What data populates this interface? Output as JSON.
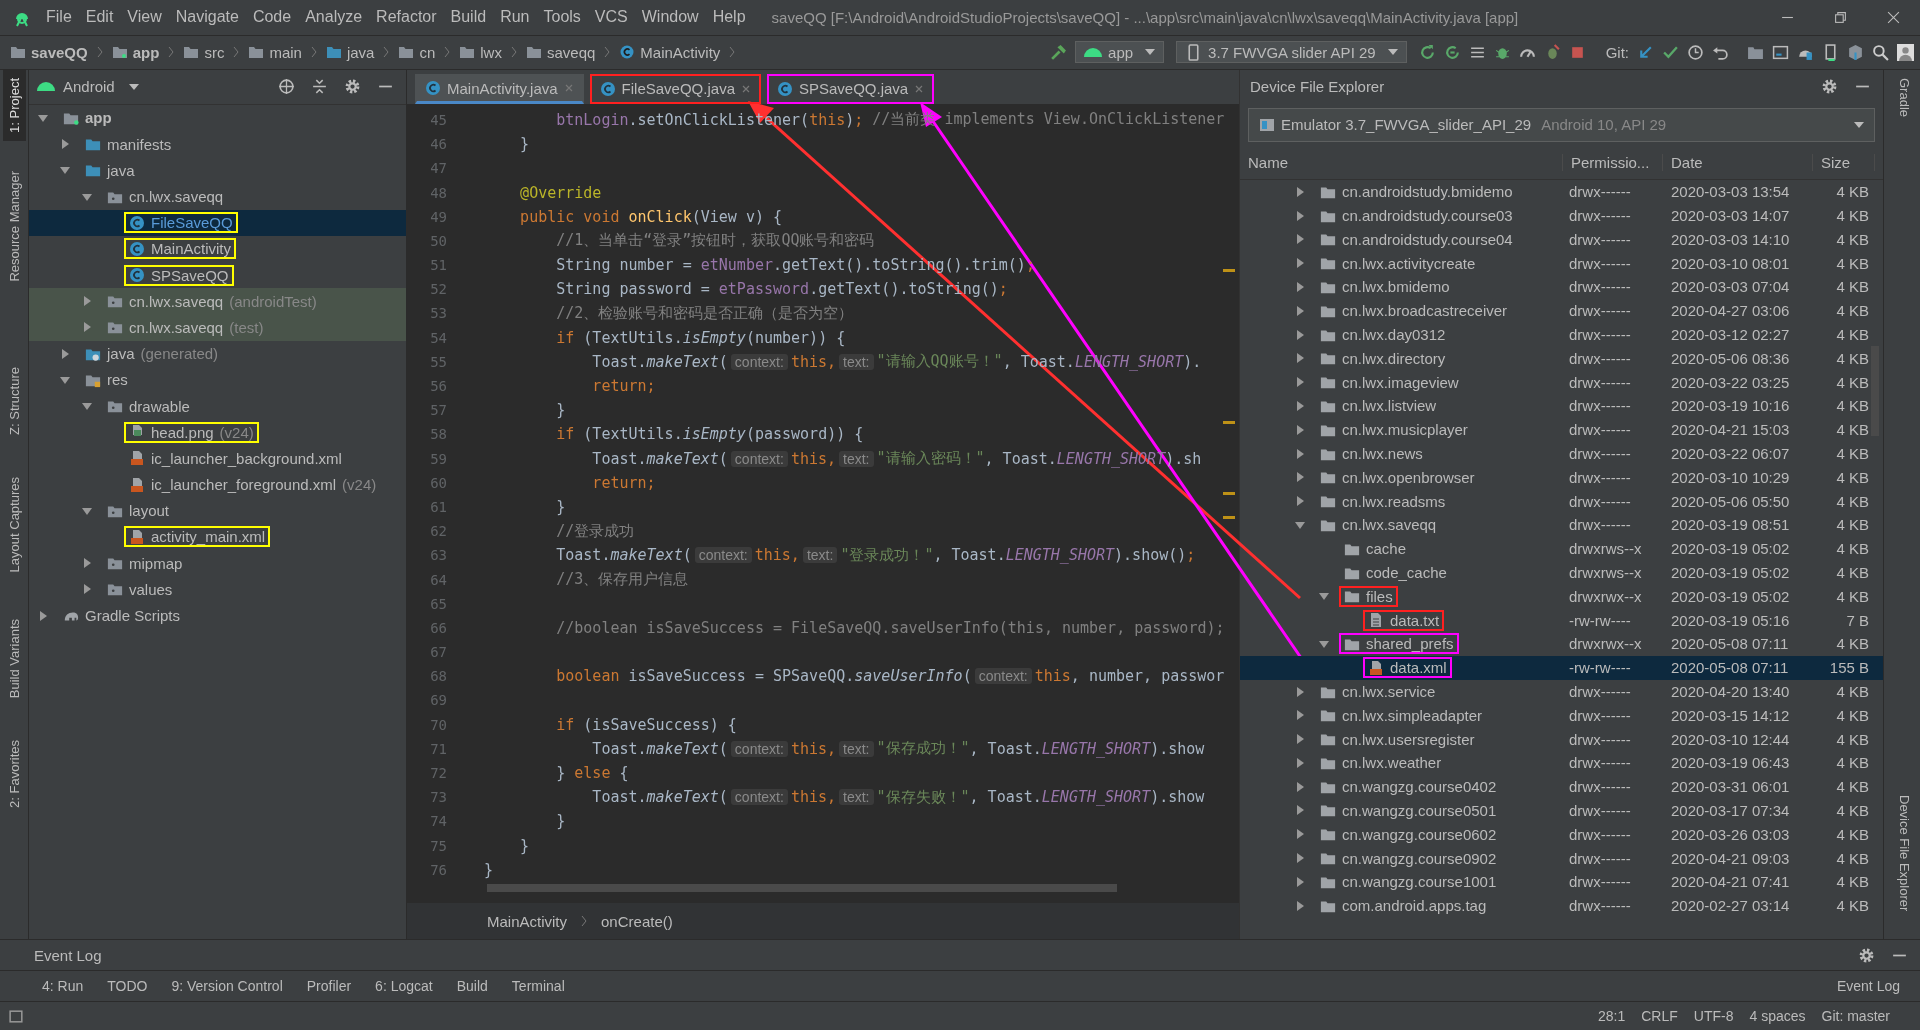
{
  "menu_bar": {
    "items": [
      "File",
      "Edit",
      "View",
      "Navigate",
      "Code",
      "Analyze",
      "Refactor",
      "Build",
      "Run",
      "Tools",
      "VCS",
      "Window",
      "Help"
    ],
    "title": "saveQQ [F:\\Android\\AndroidStudioProjects\\saveQQ] - ...\\app\\src\\main\\java\\cn\\lwx\\saveqq\\MainActivity.java [app]"
  },
  "nav_bar": {
    "breadcrumbs": [
      {
        "label": "saveQQ",
        "kind": "project"
      },
      {
        "label": "app",
        "kind": "module"
      },
      {
        "label": "src",
        "kind": "folder"
      },
      {
        "label": "main",
        "kind": "folder"
      },
      {
        "label": "java",
        "kind": "source"
      },
      {
        "label": "cn",
        "kind": "folder"
      },
      {
        "label": "lwx",
        "kind": "folder"
      },
      {
        "label": "saveqq",
        "kind": "folder"
      },
      {
        "label": "MainActivity",
        "kind": "class"
      }
    ],
    "run_config": "app",
    "device": "3.7  FWVGA slider API 29",
    "git_label": "Git:"
  },
  "left_tool_windows": [
    {
      "label": "1: Project",
      "selected": true
    },
    {
      "label": "Resource Manager",
      "selected": false
    },
    {
      "label": "Z: Structure",
      "selected": false
    },
    {
      "label": "Layout Captures",
      "selected": false
    },
    {
      "label": "Build Variants",
      "selected": false
    },
    {
      "label": "2: Favorites",
      "selected": false
    }
  ],
  "project_panel": {
    "view": "Android",
    "tree": [
      {
        "label": "app",
        "kind": "module",
        "expanded": true,
        "selected": false,
        "children": [
          {
            "label": "manifests",
            "kind": "folder",
            "expanded": false,
            "selected": false
          },
          {
            "label": "java",
            "kind": "folder",
            "expanded": true,
            "selected": false,
            "children": [
              {
                "label": "cn.lwx.saveqq",
                "kind": "package",
                "expanded": true,
                "selected": false,
                "tinted": false,
                "children": [
                  {
                    "label": "FileSaveQQ",
                    "kind": "class",
                    "selected": true,
                    "color": "#ffff00"
                  },
                  {
                    "label": "MainActivity",
                    "kind": "class",
                    "selected": false,
                    "color": "#ffff00"
                  },
                  {
                    "label": "SPSaveQQ",
                    "kind": "class",
                    "selected": false,
                    "color": "#ffff00"
                  }
                ]
              },
              {
                "label": "cn.lwx.saveqq",
                "suffix": "(androidTest)",
                "kind": "package",
                "expanded": false,
                "selected": false,
                "tinted": true
              },
              {
                "label": "cn.lwx.saveqq",
                "suffix": "(test)",
                "kind": "package",
                "expanded": false,
                "selected": false,
                "tinted": true
              }
            ]
          },
          {
            "label": "java",
            "suffix": "(generated)",
            "kind": "generated",
            "expanded": false,
            "selected": false
          },
          {
            "label": "res",
            "kind": "res",
            "expanded": true,
            "selected": false,
            "children": [
              {
                "label": "drawable",
                "kind": "package",
                "expanded": true,
                "selected": false,
                "children": [
                  {
                    "label": "head.png",
                    "suffix": "(v24)",
                    "kind": "image",
                    "selected": false,
                    "color": "#ffff00"
                  },
                  {
                    "label": "ic_launcher_background.xml",
                    "kind": "xml",
                    "selected": false
                  },
                  {
                    "label": "ic_launcher_foreground.xml",
                    "suffix": "(v24)",
                    "kind": "xml",
                    "selected": false
                  }
                ]
              },
              {
                "label": "layout",
                "kind": "package",
                "expanded": true,
                "selected": false,
                "children": [
                  {
                    "label": "activity_main.xml",
                    "kind": "xml",
                    "selected": false,
                    "color": "#ffff00"
                  }
                ]
              },
              {
                "label": "mipmap",
                "kind": "package",
                "expanded": false,
                "selected": false
              },
              {
                "label": "values",
                "kind": "package",
                "expanded": false,
                "selected": false
              }
            ]
          }
        ]
      },
      {
        "label": "Gradle Scripts",
        "kind": "gradle",
        "expanded": false,
        "selected": false
      }
    ]
  },
  "editor": {
    "tabs": [
      {
        "label": "MainActivity.java",
        "selected": true
      },
      {
        "label": "FileSaveQQ.java",
        "selected": false,
        "color": "#ff2020"
      },
      {
        "label": "SPSaveQQ.java",
        "selected": false,
        "color": "#ff00ff"
      }
    ],
    "lines": [
      {
        "number": "45",
        "tokens": [
          {
            "kind": "field",
            "text": "        btnLogin"
          },
          {
            "kind": "plain",
            "text": ".setOnClickListener("
          },
          {
            "kind": "keyword",
            "text": "this"
          },
          {
            "kind": "plain",
            "text": ")"
          },
          {
            "kind": "keyword",
            "text": ";"
          },
          {
            "kind": "comment",
            "text": " //当前类 implements View.OnClickListener"
          }
        ]
      },
      {
        "number": "46",
        "tokens": [
          {
            "kind": "plain",
            "text": "    }"
          }
        ]
      },
      {
        "number": "47"
      },
      {
        "number": "48",
        "tokens": [
          {
            "kind": "annotation",
            "text": "    @Override"
          }
        ]
      },
      {
        "number": "49",
        "tokens": [
          {
            "kind": "keyword",
            "text": "    public void "
          },
          {
            "kind": "method",
            "text": "onClick"
          },
          {
            "kind": "plain",
            "text": "(View v) {"
          }
        ]
      },
      {
        "number": "50",
        "tokens": [
          {
            "kind": "comment",
            "text": "        //1、当单击“登录”按钮时，获取QQ账号和密码"
          }
        ]
      },
      {
        "number": "51",
        "tokens": [
          {
            "kind": "plain",
            "text": "        String number = "
          },
          {
            "kind": "field",
            "text": "etNumber"
          },
          {
            "kind": "plain",
            "text": ".getText().toString().trim()"
          },
          {
            "kind": "keyword",
            "text": ";"
          }
        ]
      },
      {
        "number": "52",
        "tokens": [
          {
            "kind": "plain",
            "text": "        String password = "
          },
          {
            "kind": "field",
            "text": "etPassword"
          },
          {
            "kind": "plain",
            "text": ".getText().toString()"
          },
          {
            "kind": "keyword",
            "text": ";"
          }
        ]
      },
      {
        "number": "53",
        "tokens": [
          {
            "kind": "comment",
            "text": "        //2、检验账号和密码是否正确（是否为空）"
          }
        ]
      },
      {
        "number": "54",
        "tokens": [
          {
            "kind": "keyword",
            "text": "        if "
          },
          {
            "kind": "plain",
            "text": "(TextUtils."
          },
          {
            "kind": "italic",
            "text": "isEmpty"
          },
          {
            "kind": "plain",
            "text": "(number)) {"
          }
        ]
      },
      {
        "number": "55",
        "tokens": [
          {
            "kind": "plain",
            "text": "            Toast."
          },
          {
            "kind": "italic",
            "text": "makeText"
          },
          {
            "kind": "plain",
            "text": "("
          },
          {
            "kind": "hint",
            "text": "context:"
          },
          {
            "kind": "keyword",
            "text": "this,"
          },
          {
            "kind": "hint",
            "text": "text:"
          },
          {
            "kind": "string",
            "text": "\"请输入QQ账号！\""
          },
          {
            "kind": "plain",
            "text": ", Toast."
          },
          {
            "kind": "constant",
            "text": "LENGTH_SHORT"
          },
          {
            "kind": "plain",
            "text": ")."
          }
        ]
      },
      {
        "number": "56",
        "tokens": [
          {
            "kind": "keyword",
            "text": "            return;"
          }
        ]
      },
      {
        "number": "57",
        "tokens": [
          {
            "kind": "plain",
            "text": "        }"
          }
        ]
      },
      {
        "number": "58",
        "tokens": [
          {
            "kind": "keyword",
            "text": "        if "
          },
          {
            "kind": "plain",
            "text": "(TextUtils."
          },
          {
            "kind": "italic",
            "text": "isEmpty"
          },
          {
            "kind": "plain",
            "text": "(password)) {"
          }
        ]
      },
      {
        "number": "59",
        "tokens": [
          {
            "kind": "plain",
            "text": "            Toast."
          },
          {
            "kind": "italic",
            "text": "makeText"
          },
          {
            "kind": "plain",
            "text": "("
          },
          {
            "kind": "hint",
            "text": "context:"
          },
          {
            "kind": "keyword",
            "text": "this,"
          },
          {
            "kind": "hint",
            "text": "text:"
          },
          {
            "kind": "string",
            "text": "\"请输入密码！\""
          },
          {
            "kind": "plain",
            "text": ", Toast."
          },
          {
            "kind": "constant",
            "text": "LENGTH_SHORT"
          },
          {
            "kind": "plain",
            "text": ").sh"
          }
        ]
      },
      {
        "number": "60",
        "tokens": [
          {
            "kind": "keyword",
            "text": "            return;"
          }
        ]
      },
      {
        "number": "61",
        "tokens": [
          {
            "kind": "plain",
            "text": "        }"
          }
        ]
      },
      {
        "number": "62",
        "tokens": [
          {
            "kind": "comment",
            "text": "        //登录成功"
          }
        ]
      },
      {
        "number": "63",
        "tokens": [
          {
            "kind": "plain",
            "text": "        Toast."
          },
          {
            "kind": "italic",
            "text": "makeText"
          },
          {
            "kind": "plain",
            "text": "("
          },
          {
            "kind": "hint",
            "text": "context:"
          },
          {
            "kind": "keyword",
            "text": "this,"
          },
          {
            "kind": "hint",
            "text": "text:"
          },
          {
            "kind": "string",
            "text": "\"登录成功！\""
          },
          {
            "kind": "plain",
            "text": ", Toast."
          },
          {
            "kind": "constant",
            "text": "LENGTH_SHORT"
          },
          {
            "kind": "plain",
            "text": ").show()"
          },
          {
            "kind": "keyword",
            "text": ";"
          }
        ]
      },
      {
        "number": "64",
        "tokens": [
          {
            "kind": "comment",
            "text": "        //3、保存用户信息"
          }
        ]
      },
      {
        "number": "65"
      },
      {
        "number": "66",
        "tokens": [
          {
            "kind": "comment",
            "text": "        //boolean isSaveSuccess = FileSaveQQ.saveUserInfo(this, number, password);"
          }
        ]
      },
      {
        "number": "67"
      },
      {
        "number": "68",
        "tokens": [
          {
            "kind": "keyword",
            "text": "        boolean "
          },
          {
            "kind": "plain",
            "text": "isSaveSuccess = SPSaveQQ."
          },
          {
            "kind": "italic",
            "text": "saveUserInfo"
          },
          {
            "kind": "plain",
            "text": "("
          },
          {
            "kind": "hint",
            "text": "context:"
          },
          {
            "kind": "keyword",
            "text": "this"
          },
          {
            "kind": "plain",
            "text": ", number, passwor"
          }
        ]
      },
      {
        "number": "69"
      },
      {
        "number": "70",
        "tokens": [
          {
            "kind": "keyword",
            "text": "        if "
          },
          {
            "kind": "plain",
            "text": "(isSaveSuccess) {"
          }
        ]
      },
      {
        "number": "71",
        "tokens": [
          {
            "kind": "plain",
            "text": "            Toast."
          },
          {
            "kind": "italic",
            "text": "makeText"
          },
          {
            "kind": "plain",
            "text": "("
          },
          {
            "kind": "hint",
            "text": "context:"
          },
          {
            "kind": "keyword",
            "text": "this,"
          },
          {
            "kind": "hint",
            "text": "text:"
          },
          {
            "kind": "string",
            "text": "\"保存成功！\""
          },
          {
            "kind": "plain",
            "text": ", Toast."
          },
          {
            "kind": "constant",
            "text": "LENGTH_SHORT"
          },
          {
            "kind": "plain",
            "text": ").show"
          }
        ]
      },
      {
        "number": "72",
        "tokens": [
          {
            "kind": "plain",
            "text": "        } "
          },
          {
            "kind": "keyword",
            "text": "else "
          },
          {
            "kind": "plain",
            "text": "{"
          }
        ]
      },
      {
        "number": "73",
        "tokens": [
          {
            "kind": "plain",
            "text": "            Toast."
          },
          {
            "kind": "italic",
            "text": "makeText"
          },
          {
            "kind": "plain",
            "text": "("
          },
          {
            "kind": "hint",
            "text": "context:"
          },
          {
            "kind": "keyword",
            "text": "this,"
          },
          {
            "kind": "hint",
            "text": "text:"
          },
          {
            "kind": "string",
            "text": "\"保存失败！\""
          },
          {
            "kind": "plain",
            "text": ", Toast."
          },
          {
            "kind": "constant",
            "text": "LENGTH_SHORT"
          },
          {
            "kind": "plain",
            "text": ").show"
          }
        ]
      },
      {
        "number": "74",
        "tokens": [
          {
            "kind": "plain",
            "text": "        }"
          }
        ]
      },
      {
        "number": "75",
        "tokens": [
          {
            "kind": "plain",
            "text": "    }"
          }
        ]
      },
      {
        "number": "76",
        "tokens": [
          {
            "kind": "plain",
            "text": "}"
          }
        ]
      }
    ],
    "breadcrumbs": [
      "MainActivity",
      "onCreate()"
    ]
  },
  "device_file_explorer": {
    "title": "Device File Explorer",
    "device": "Emulator 3.7_FWVGA_slider_API_29",
    "device_info": "Android 10, API 29",
    "columns": [
      "Name",
      "Permissio...",
      "Date",
      "Size"
    ],
    "rows": [
      {
        "name": "cn.androidstudy.bmidemo",
        "kind": "folder",
        "expanded": false,
        "selected": false,
        "permissions": "drwx------",
        "date": "2020-03-03 13:54",
        "size": "4 KB"
      },
      {
        "name": "cn.androidstudy.course03",
        "kind": "folder",
        "expanded": false,
        "selected": false,
        "permissions": "drwx------",
        "date": "2020-03-03 14:07",
        "size": "4 KB"
      },
      {
        "name": "cn.androidstudy.course04",
        "kind": "folder",
        "expanded": false,
        "selected": false,
        "permissions": "drwx------",
        "date": "2020-03-03 14:10",
        "size": "4 KB"
      },
      {
        "name": "cn.lwx.activitycreate",
        "kind": "folder",
        "expanded": false,
        "selected": false,
        "permissions": "drwx------",
        "date": "2020-03-10 08:01",
        "size": "4 KB"
      },
      {
        "name": "cn.lwx.bmidemo",
        "kind": "folder",
        "expanded": false,
        "selected": false,
        "permissions": "drwx------",
        "date": "2020-03-03 07:04",
        "size": "4 KB"
      },
      {
        "name": "cn.lwx.broadcastreceiver",
        "kind": "folder",
        "expanded": false,
        "selected": false,
        "permissions": "drwx------",
        "date": "2020-04-27 03:06",
        "size": "4 KB"
      },
      {
        "name": "cn.lwx.day0312",
        "kind": "folder",
        "expanded": false,
        "selected": false,
        "permissions": "drwx------",
        "date": "2020-03-12 02:27",
        "size": "4 KB"
      },
      {
        "name": "cn.lwx.directory",
        "kind": "folder",
        "expanded": false,
        "selected": false,
        "permissions": "drwx------",
        "date": "2020-05-06 08:36",
        "size": "4 KB"
      },
      {
        "name": "cn.lwx.imageview",
        "kind": "folder",
        "expanded": false,
        "selected": false,
        "permissions": "drwx------",
        "date": "2020-03-22 03:25",
        "size": "4 KB"
      },
      {
        "name": "cn.lwx.listview",
        "kind": "folder",
        "expanded": false,
        "selected": false,
        "permissions": "drwx------",
        "date": "2020-03-19 10:16",
        "size": "4 KB"
      },
      {
        "name": "cn.lwx.musicplayer",
        "kind": "folder",
        "expanded": false,
        "selected": false,
        "permissions": "drwx------",
        "date": "2020-04-21 15:03",
        "size": "4 KB"
      },
      {
        "name": "cn.lwx.news",
        "kind": "folder",
        "expanded": false,
        "selected": false,
        "permissions": "drwx------",
        "date": "2020-03-22 06:07",
        "size": "4 KB"
      },
      {
        "name": "cn.lwx.openbrowser",
        "kind": "folder",
        "expanded": false,
        "selected": false,
        "permissions": "drwx------",
        "date": "2020-03-10 10:29",
        "size": "4 KB"
      },
      {
        "name": "cn.lwx.readsms",
        "kind": "folder",
        "expanded": false,
        "selected": false,
        "permissions": "drwx------",
        "date": "2020-05-06 05:50",
        "size": "4 KB"
      },
      {
        "name": "cn.lwx.saveqq",
        "kind": "folder",
        "expanded": true,
        "selected": false,
        "permissions": "drwx------",
        "date": "2020-03-19 08:51",
        "size": "4 KB",
        "children": [
          {
            "name": "cache",
            "kind": "folder",
            "selected": false,
            "permissions": "drwxrws--x",
            "date": "2020-03-19 05:02",
            "size": "4 KB"
          },
          {
            "name": "code_cache",
            "kind": "folder",
            "selected": false,
            "permissions": "drwxrws--x",
            "date": "2020-03-19 05:02",
            "size": "4 KB"
          },
          {
            "name": "files",
            "kind": "folder",
            "expanded": true,
            "selected": false,
            "color": "#ff2020",
            "permissions": "drwxrwx--x",
            "date": "2020-03-19 05:02",
            "size": "4 KB",
            "children": [
              {
                "name": "data.txt",
                "kind": "file",
                "selected": false,
                "color": "#ff2020",
                "permissions": "-rw-rw----",
                "date": "2020-03-19 05:16",
                "size": "7 B"
              }
            ]
          },
          {
            "name": "shared_prefs",
            "kind": "folder",
            "expanded": true,
            "selected": false,
            "color": "#ff00ff",
            "permissions": "drwxrwx--x",
            "date": "2020-05-08 07:11",
            "size": "4 KB",
            "children": [
              {
                "name": "data.xml",
                "kind": "xml",
                "selected": true,
                "color": "#ff00ff",
                "permissions": "-rw-rw----",
                "date": "2020-05-08 07:11",
                "size": "155 B"
              }
            ]
          }
        ]
      },
      {
        "name": "cn.lwx.service",
        "kind": "folder",
        "expanded": false,
        "selected": false,
        "permissions": "drwx------",
        "date": "2020-04-20 13:40",
        "size": "4 KB"
      },
      {
        "name": "cn.lwx.simpleadapter",
        "kind": "folder",
        "expanded": false,
        "selected": false,
        "permissions": "drwx------",
        "date": "2020-03-15 14:12",
        "size": "4 KB"
      },
      {
        "name": "cn.lwx.usersregister",
        "kind": "folder",
        "expanded": false,
        "selected": false,
        "permissions": "drwx------",
        "date": "2020-03-10 12:44",
        "size": "4 KB"
      },
      {
        "name": "cn.lwx.weather",
        "kind": "folder",
        "expanded": false,
        "selected": false,
        "permissions": "drwx------",
        "date": "2020-03-19 06:43",
        "size": "4 KB"
      },
      {
        "name": "cn.wangzg.course0402",
        "kind": "folder",
        "expanded": false,
        "selected": false,
        "permissions": "drwx------",
        "date": "2020-03-31 06:01",
        "size": "4 KB"
      },
      {
        "name": "cn.wangzg.course0501",
        "kind": "folder",
        "expanded": false,
        "selected": false,
        "permissions": "drwx------",
        "date": "2020-03-17 07:34",
        "size": "4 KB"
      },
      {
        "name": "cn.wangzg.course0602",
        "kind": "folder",
        "expanded": false,
        "selected": false,
        "permissions": "drwx------",
        "date": "2020-03-26 03:03",
        "size": "4 KB"
      },
      {
        "name": "cn.wangzg.course0902",
        "kind": "folder",
        "expanded": false,
        "selected": false,
        "permissions": "drwx------",
        "date": "2020-04-21 09:03",
        "size": "4 KB"
      },
      {
        "name": "cn.wangzg.course1001",
        "kind": "folder",
        "expanded": false,
        "selected": false,
        "permissions": "drwx------",
        "date": "2020-04-21 07:41",
        "size": "4 KB"
      },
      {
        "name": "com.android.apps.tag",
        "kind": "folder",
        "expanded": false,
        "selected": false,
        "permissions": "drwx------",
        "date": "2020-02-27 03:14",
        "size": "4 KB"
      }
    ]
  },
  "right_tool_windows": [
    "Gradle",
    "Device File Explorer"
  ],
  "event_log": {
    "title": "Event Log"
  },
  "bottom_tools": [
    "4: Run",
    "TODO",
    "9: Version Control",
    "Profiler",
    "6: Logcat",
    "Build",
    "Terminal"
  ],
  "bottom_right_tool": "Event Log",
  "status_bar": [
    "28:1",
    "CRLF",
    "UTF-8",
    "4 spaces",
    "Git: master"
  ]
}
